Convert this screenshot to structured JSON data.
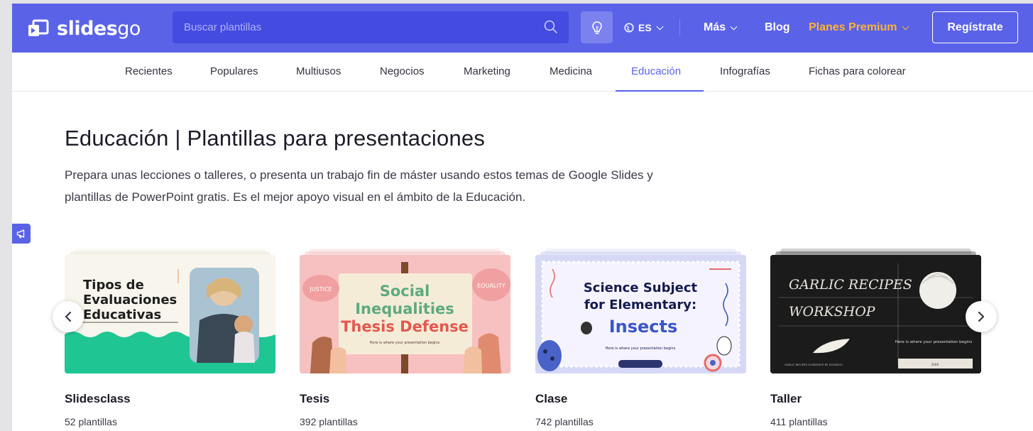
{
  "header": {
    "logo_text_bold": "slides",
    "logo_text_light": "go",
    "search_placeholder": "Buscar plantillas",
    "language": "ES",
    "nav_more": "Más",
    "nav_blog": "Blog",
    "nav_premium": "Planes Premium",
    "register_label": "Regístrate"
  },
  "subnav": {
    "items": [
      "Recientes",
      "Populares",
      "Multiusos",
      "Negocios",
      "Marketing",
      "Medicina",
      "Educación",
      "Infografías",
      "Fichas para colorear"
    ],
    "active": "Educación"
  },
  "main": {
    "title": "Educación | Plantillas para presentaciones",
    "description": "Prepara unas lecciones o talleres, o presenta un trabajo fin de máster usando estos temas de Google Slides y plantillas de PowerPoint gratis. Es el mejor apoyo visual en el ámbito de la Educación."
  },
  "cards": [
    {
      "title": "Slidesclass",
      "count": "52 plantillas",
      "thumb_text": [
        "Tipos de",
        "Evaluaciones",
        "Educativas"
      ]
    },
    {
      "title": "Tesis",
      "count": "392 plantillas",
      "thumb_text": [
        "Social",
        "Inequalities",
        "Thesis Defense",
        "Here is where your presentation begins",
        "JUSTICE",
        "EQUALITY"
      ]
    },
    {
      "title": "Clase",
      "count": "742 plantillas",
      "thumb_text": [
        "Science Subject",
        "for Elementary:",
        "Insects",
        "Here is where your presentation begins"
      ]
    },
    {
      "title": "Taller",
      "count": "411 plantillas",
      "thumb_text": [
        "GARLIC RECIPES",
        "WORKSHOP",
        "Here is where your presentation begins",
        "GARLIC RECIPES WORKSHOP BY SLIDESGO",
        "20XX"
      ]
    }
  ],
  "colors": {
    "brand": "#5a62e8",
    "premium": "#ffb330",
    "text_dark": "#1c1c28"
  },
  "icons": [
    "logo-icon",
    "search-icon",
    "lightbulb-icon",
    "globe-icon",
    "chevron-down-icon",
    "megaphone-icon",
    "chevron-left-icon",
    "chevron-right-icon"
  ]
}
